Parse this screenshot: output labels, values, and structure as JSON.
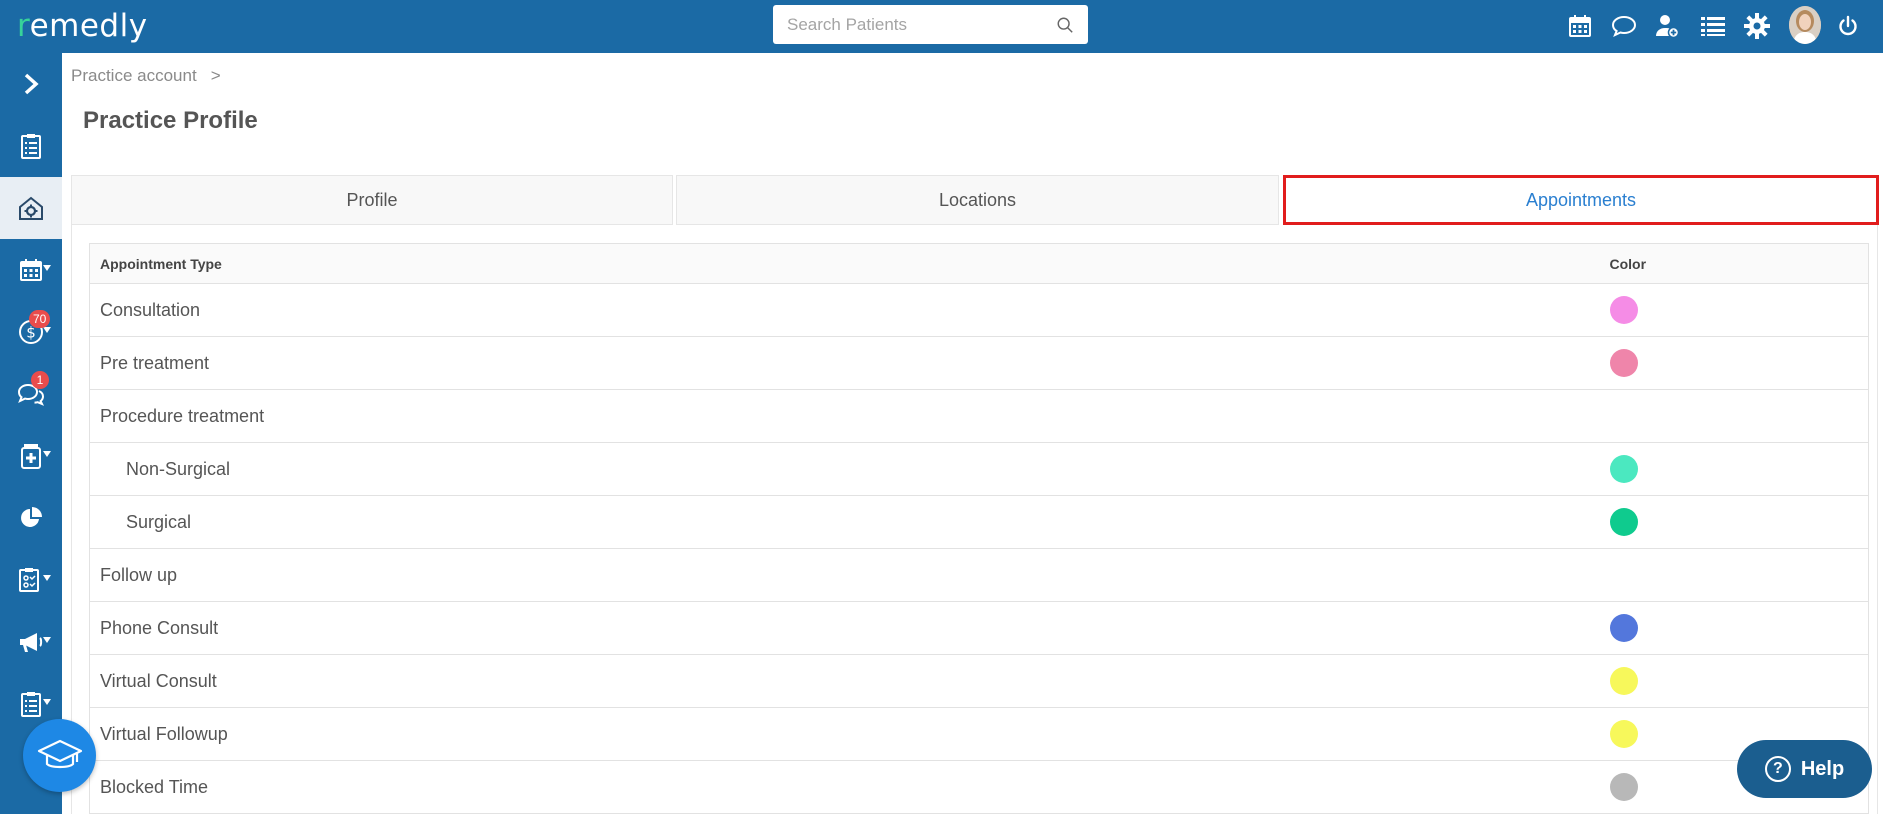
{
  "app": {
    "logo_prefix": "r",
    "logo_rest": "emedly"
  },
  "search": {
    "placeholder": "Search Patients"
  },
  "top_icons": [
    "calendar-icon",
    "chat-icon",
    "add-user-icon",
    "list-icon",
    "gear-icon",
    "avatar",
    "power-icon"
  ],
  "sidebar": {
    "badges": {
      "billing": "70",
      "messages": "1"
    }
  },
  "breadcrumb": {
    "item": "Practice account",
    "separator": ">"
  },
  "page": {
    "title": "Practice Profile"
  },
  "tabs": [
    {
      "label": "Profile"
    },
    {
      "label": "Locations"
    },
    {
      "label": "Appointments",
      "active": true
    }
  ],
  "table": {
    "headers": {
      "type": "Appointment Type",
      "color": "Color"
    },
    "rows": [
      {
        "type": "Consultation",
        "color": "#f58ce6",
        "indent": false
      },
      {
        "type": "Pre treatment",
        "color": "#ef85aa",
        "indent": false
      },
      {
        "type": "Procedure treatment",
        "color": "",
        "indent": false
      },
      {
        "type": "Non-Surgical",
        "color": "#4be8c0",
        "indent": true
      },
      {
        "type": "Surgical",
        "color": "#0fcb8e",
        "indent": true
      },
      {
        "type": "Follow up",
        "color": "",
        "indent": false
      },
      {
        "type": "Phone Consult",
        "color": "#5377dc",
        "indent": false
      },
      {
        "type": "Virtual Consult",
        "color": "#f7f85b",
        "indent": false
      },
      {
        "type": "Virtual Followup",
        "color": "#f7f85b",
        "indent": false
      },
      {
        "type": "Blocked Time",
        "color": "#b8b8b8",
        "indent": false
      }
    ]
  },
  "help": {
    "label": "Help"
  },
  "colors": {
    "brand": "#1b6aa5",
    "accent": "#37d39a",
    "active_tab_text": "#2a7fd0",
    "highlight": "#e11d1d"
  }
}
